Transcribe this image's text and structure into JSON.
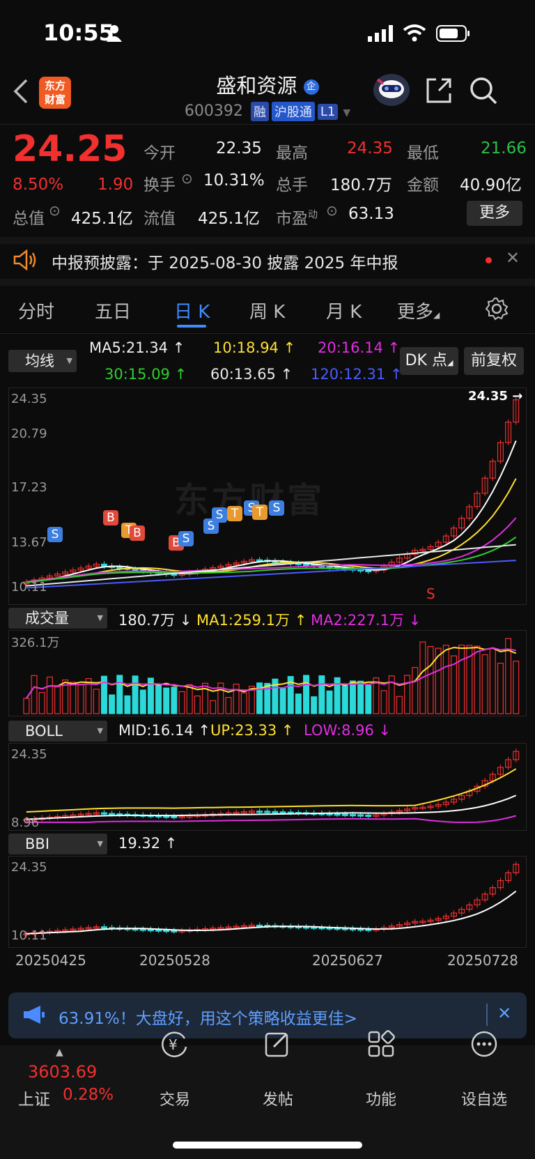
{
  "status_bar": {
    "time": "10:55"
  },
  "header": {
    "logo_text": "东方\n财富",
    "title": "盛和资源",
    "title_badge": "企",
    "code": "600392",
    "tags": [
      "融",
      "沪股通",
      "L1"
    ]
  },
  "quote": {
    "price": "24.25",
    "change_pct": "8.50%",
    "change": "1.90",
    "open_label": "今开",
    "open": "22.35",
    "high_label": "最高",
    "high": "24.35",
    "low_label": "最低",
    "low": "21.66",
    "turnover_label": "换手",
    "turnover": "10.31%",
    "volume_label": "总手",
    "volume": "180.7万",
    "amount_label": "金额",
    "amount": "40.90亿",
    "mktcap_label": "总值",
    "mktcap": "425.1亿",
    "float_label": "流值",
    "float": "425.1亿",
    "pe_label": "市盈",
    "pe_sup": "动",
    "pe": "63.13",
    "more_label": "更多"
  },
  "notice": {
    "text": "中报预披露：于 2025-08-30 披露 2025 年中报"
  },
  "tabs": [
    "分时",
    "五日",
    "日 K",
    "周 K",
    "月 K",
    "更多"
  ],
  "active_tab": "日 K",
  "ma_row": {
    "selector": "均线",
    "ma5": "MA5:21.34 ↑",
    "ma10": "10:18.94 ↑",
    "ma20": "20:16.14 ↑",
    "ma30": "30:15.09 ↑",
    "ma60": "60:13.65 ↑",
    "ma120": "120:12.31 ↑",
    "dk_button": "DK 点",
    "restore_button": "前复权"
  },
  "kline": {
    "y_labels": [
      "24.35",
      "20.79",
      "17.23",
      "13.67",
      "10.11"
    ],
    "last_marker": "24.35 →",
    "watermark": "东方财富",
    "signals": [
      "S",
      "B",
      "T",
      "B",
      "B",
      "S",
      "S",
      "S",
      "T",
      "S",
      "T",
      "S",
      "S"
    ]
  },
  "volume": {
    "selector": "成交量",
    "value": "180.7万 ↓",
    "ma1": "MA1:259.1万 ↑",
    "ma2": "MA2:227.1万 ↓",
    "y_max": "326.1万"
  },
  "boll": {
    "selector": "BOLL",
    "mid": "MID:16.14 ↑",
    "up": "UP:23.33 ↑",
    "low": "LOW:8.96 ↓",
    "y_top": "24.35",
    "y_bottom": "8.96"
  },
  "bbi": {
    "selector": "BBI",
    "value": "19.32 ↑",
    "y_top": "24.35",
    "y_bottom": "10.11"
  },
  "x_axis_dates": [
    "20250425",
    "20250528",
    "20250627",
    "20250728"
  ],
  "banner": {
    "text": "63.91%！大盘好，用这个策略收益更佳>"
  },
  "bottom_nav": {
    "index_value": "3603.69",
    "index_name": "上证",
    "index_change": "0.28%",
    "items": [
      {
        "label": "交易",
        "icon": "yen-circle-icon"
      },
      {
        "label": "发帖",
        "icon": "edit-icon"
      },
      {
        "label": "功能",
        "icon": "grid-icon"
      },
      {
        "label": "设自选",
        "icon": "more-circle-icon"
      }
    ]
  },
  "colors": {
    "up": "#f23030",
    "down": "#2bd9d9",
    "accent": "#3f8cff"
  }
}
